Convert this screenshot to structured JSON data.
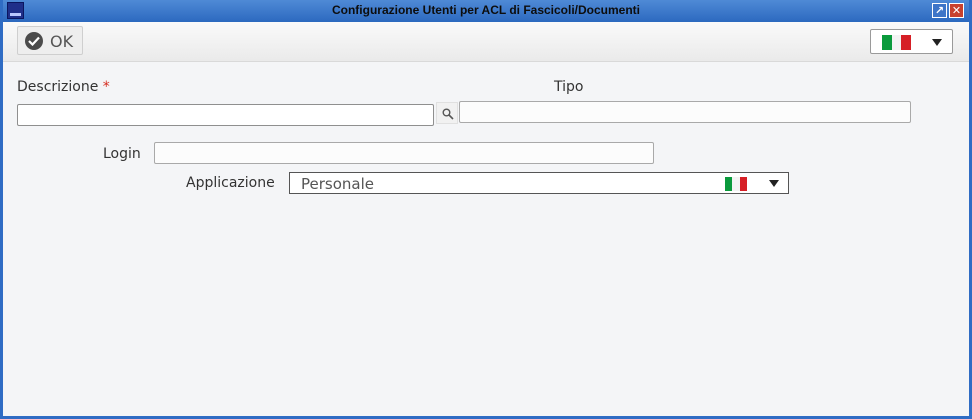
{
  "window": {
    "title": "Configurazione Utenti per ACL di Fascicoli/Documenti",
    "restore_glyph": "↗",
    "close_glyph": "✕"
  },
  "toolbar": {
    "ok_label": "OK",
    "ok_icon": "check-circle-icon",
    "language_flag": "italian-flag"
  },
  "form": {
    "descrizione_label": "Descrizione",
    "required_marker": "*",
    "descrizione_value": "",
    "tipo_label": "Tipo",
    "tipo_value": "",
    "login_label": "Login",
    "login_value": "",
    "applicazione_label": "Applicazione",
    "applicazione_value": "Personale"
  },
  "colors": {
    "titlebar": "#2c69bf",
    "required": "#d62d20",
    "background": "#f4f5f7"
  }
}
